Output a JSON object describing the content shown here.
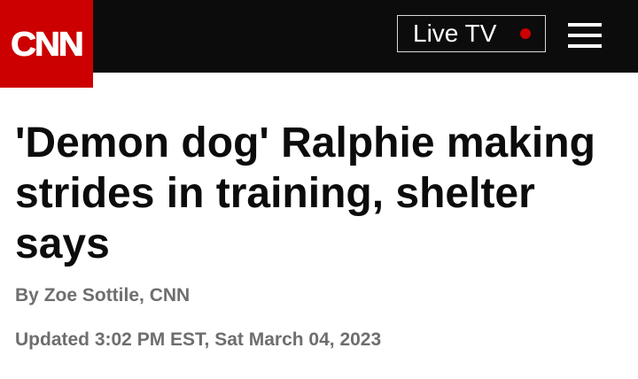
{
  "header": {
    "logo_text": "CNN",
    "live_tv_label": "Live TV",
    "live_indicator_color": "#cc0000",
    "menu_icon": "hamburger-menu-icon",
    "background_color": "#0c0c0c",
    "logo_background_color": "#cc0000"
  },
  "article": {
    "headline": "'Demon dog' Ralphie making strides in training, shelter says",
    "byline_prefix": "By ",
    "author": "Zoe Sottile",
    "byline_suffix": ", CNN",
    "timestamp": "Updated 3:02 PM EST, Sat March 04, 2023"
  }
}
